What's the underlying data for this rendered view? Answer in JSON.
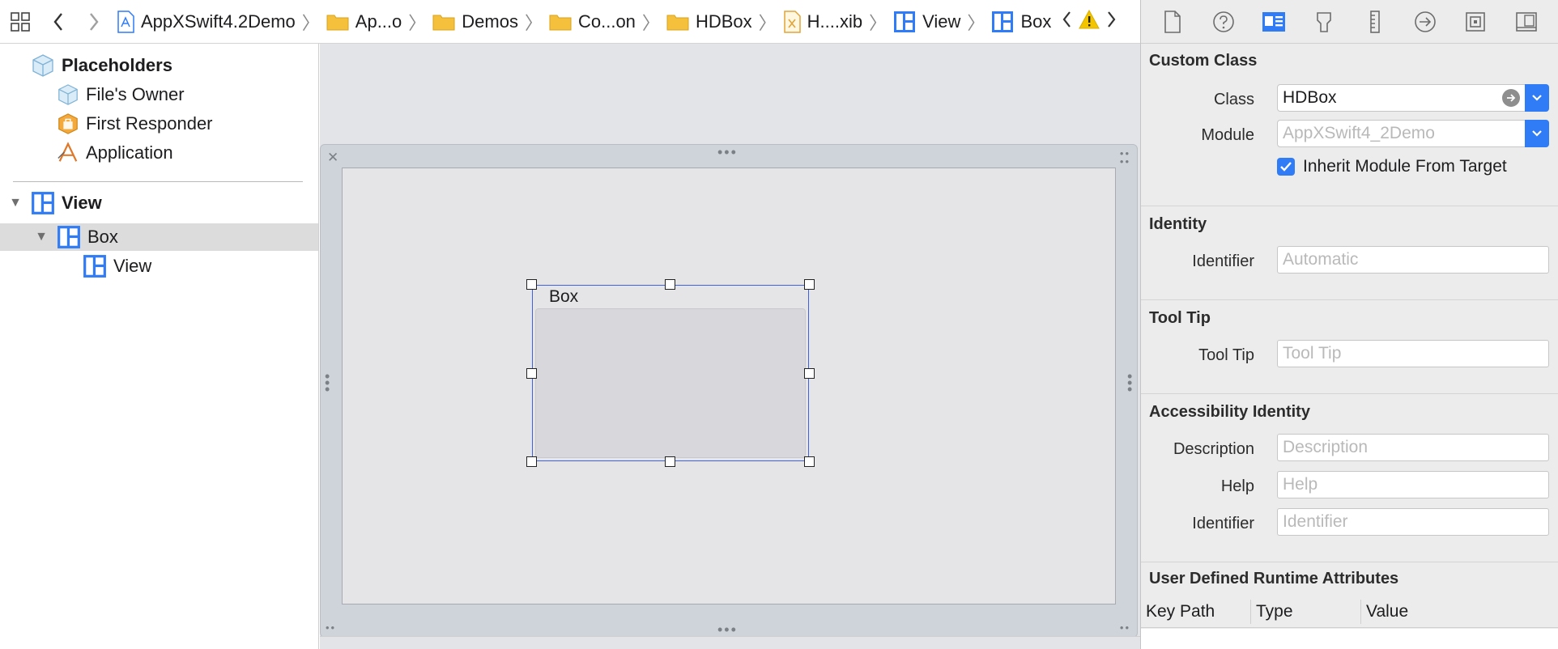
{
  "jumpbar": {
    "crumbs": [
      {
        "label": "AppXSwift4.2Demo",
        "icon": "swift-project-icon"
      },
      {
        "label": "Ap...o",
        "icon": "folder-icon"
      },
      {
        "label": "Demos",
        "icon": "folder-icon"
      },
      {
        "label": "Co...on",
        "icon": "folder-icon"
      },
      {
        "label": "HDBox",
        "icon": "folder-icon"
      },
      {
        "label": "H....xib",
        "icon": "xib-file-icon"
      },
      {
        "label": "View",
        "icon": "view-icon"
      },
      {
        "label": "Box",
        "icon": "view-icon"
      }
    ],
    "colors": {
      "folder": "#f5c03b",
      "view": "#2f7cf6",
      "warning": "#f2c500"
    }
  },
  "outline": {
    "placeholders_label": "Placeholders",
    "files_owner_label": "File's Owner",
    "first_responder_label": "First Responder",
    "application_label": "Application",
    "view_label": "View",
    "box_label": "Box",
    "child_view_label": "View"
  },
  "canvas": {
    "box_title": "Box"
  },
  "inspector": {
    "tabs": [
      "file-inspector-icon",
      "help-inspector-icon",
      "identity-inspector-icon",
      "attributes-inspector-icon",
      "size-inspector-icon",
      "connections-inspector-icon",
      "bindings-inspector-icon",
      "effects-inspector-icon"
    ],
    "custom_class": {
      "title": "Custom Class",
      "class_label": "Class",
      "class_value": "HDBox",
      "module_label": "Module",
      "module_placeholder": "AppXSwift4_2Demo",
      "inherit_label": "Inherit Module From Target",
      "inherit_checked": true
    },
    "identity": {
      "title": "Identity",
      "identifier_label": "Identifier",
      "identifier_placeholder": "Automatic"
    },
    "tool_tip": {
      "title": "Tool Tip",
      "label": "Tool Tip",
      "placeholder": "Tool Tip"
    },
    "accessibility": {
      "title": "Accessibility Identity",
      "description_label": "Description",
      "description_placeholder": "Description",
      "help_label": "Help",
      "help_placeholder": "Help",
      "identifier_label": "Identifier",
      "identifier_placeholder": "Identifier"
    },
    "runtime_attributes": {
      "title": "User Defined Runtime Attributes",
      "columns": [
        "Key Path",
        "Type",
        "Value"
      ]
    },
    "accent": "#2f7cf6"
  }
}
